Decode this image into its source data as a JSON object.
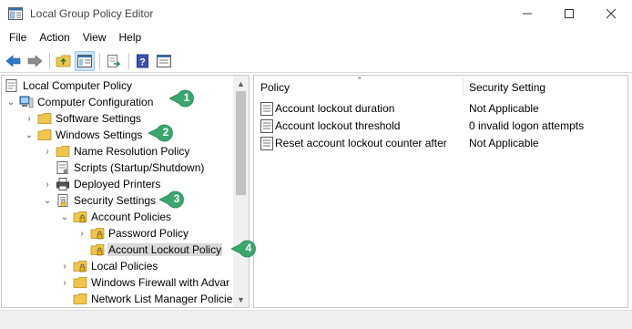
{
  "window": {
    "title": "Local Group Policy Editor"
  },
  "menu": [
    "File",
    "Action",
    "View",
    "Help"
  ],
  "toolbar_icons": [
    "back-arrow-icon",
    "forward-arrow-icon",
    "up-folder-icon",
    "show-hide-tree-icon",
    "export-list-icon",
    "help-icon",
    "properties-icon"
  ],
  "tree": [
    {
      "label": "Local Computer Policy",
      "icon": "computer-policy-icon",
      "expander": ""
    },
    {
      "label": "Computer Configuration",
      "icon": "computer-icon",
      "expander": "expanded"
    },
    {
      "label": "Software Settings",
      "icon": "folder-icon",
      "expander": "collapsed"
    },
    {
      "label": "Windows Settings",
      "icon": "folder-icon",
      "expander": "expanded"
    },
    {
      "label": "Name Resolution Policy",
      "icon": "folder-icon",
      "expander": "collapsed"
    },
    {
      "label": "Scripts (Startup/Shutdown)",
      "icon": "scripts-icon",
      "expander": ""
    },
    {
      "label": "Deployed Printers",
      "icon": "printer-icon",
      "expander": "collapsed"
    },
    {
      "label": "Security Settings",
      "icon": "security-settings-icon",
      "expander": "expanded"
    },
    {
      "label": "Account Policies",
      "icon": "locked-folder-icon",
      "expander": "expanded"
    },
    {
      "label": "Password Policy",
      "icon": "locked-folder-icon",
      "expander": "collapsed"
    },
    {
      "label": "Account Lockout Policy",
      "icon": "locked-folder-icon",
      "expander": "",
      "selected": true
    },
    {
      "label": "Local Policies",
      "icon": "locked-folder-icon",
      "expander": "collapsed"
    },
    {
      "label": "Windows Firewall with Advar",
      "icon": "folder-icon",
      "expander": "collapsed"
    },
    {
      "label": "Network List Manager Policie",
      "icon": "folder-icon",
      "expander": ""
    }
  ],
  "list": {
    "columns": [
      "Policy",
      "Security Setting"
    ],
    "rows": [
      {
        "policy": "Account lockout duration",
        "setting": "Not Applicable"
      },
      {
        "policy": "Account lockout threshold",
        "setting": "0 invalid logon attempts"
      },
      {
        "policy": "Reset account lockout counter after",
        "setting": "Not Applicable"
      }
    ]
  },
  "callouts": [
    "1",
    "2",
    "3",
    "4"
  ],
  "colors": {
    "callout": "#3aa76d",
    "selection": "#d9d9d9",
    "folder": "#f0c64a"
  }
}
